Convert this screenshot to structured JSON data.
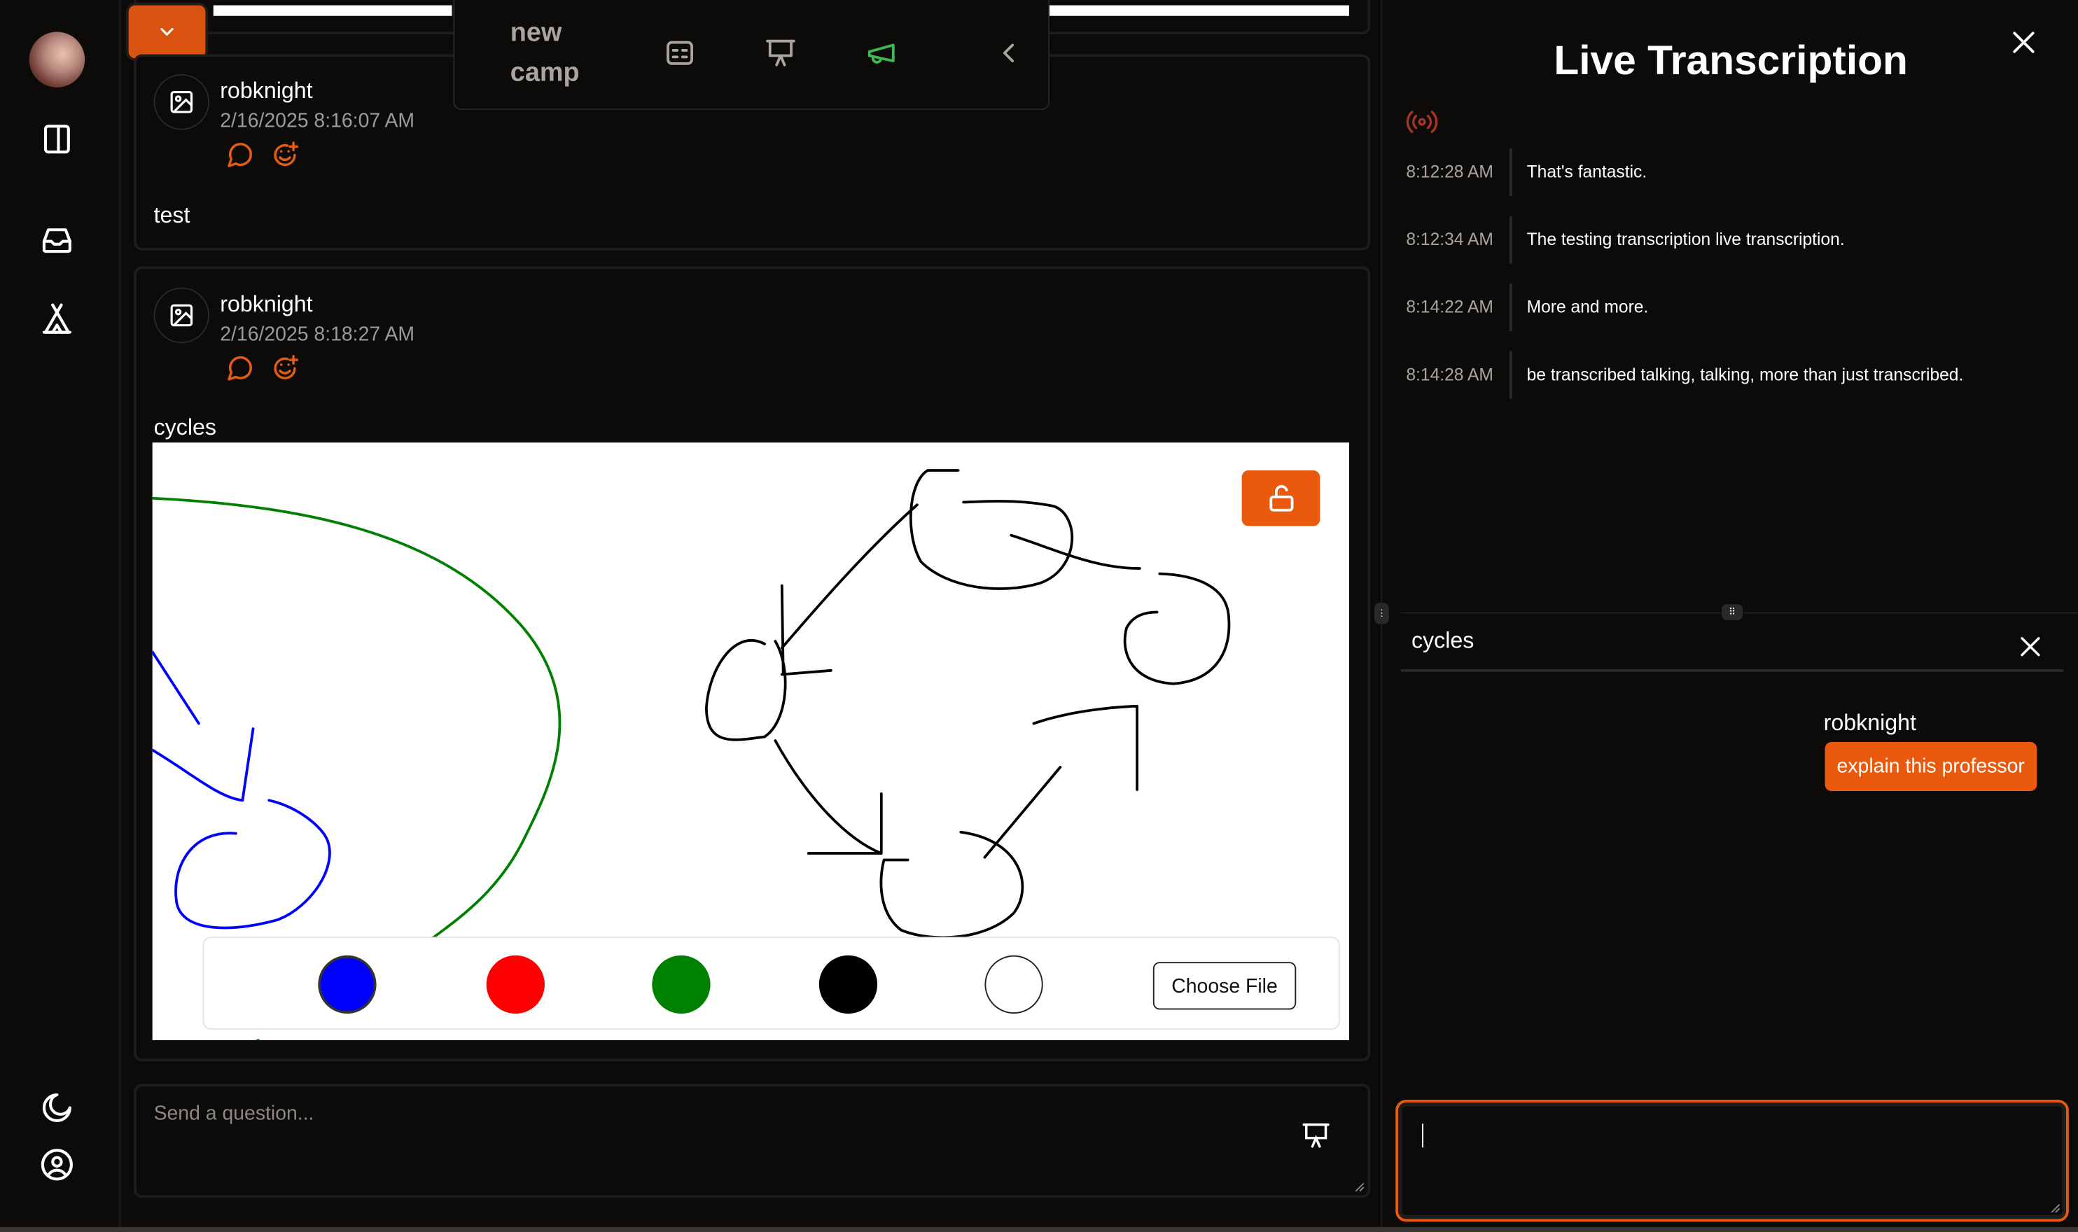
{
  "sidebar": {
    "items": [
      {
        "icon": "avatar",
        "label": "User avatar"
      },
      {
        "icon": "panel-icon",
        "label": "Toggle panel"
      },
      {
        "icon": "inbox-icon",
        "label": "Inbox"
      },
      {
        "icon": "camp-tent-icon",
        "label": "Camps"
      }
    ],
    "bottom": [
      {
        "icon": "moon-icon",
        "label": "Theme"
      },
      {
        "icon": "user-circle-icon",
        "label": "Profile"
      }
    ]
  },
  "toolbar": {
    "title": "new camp",
    "icons": [
      "captions-icon",
      "presentation-icon",
      "megaphone-icon",
      "chevron-left-icon"
    ],
    "megaphone_color": "#3dbb52"
  },
  "messages": [
    {
      "user": "robknight",
      "time": "2/16/2025 8:16:07 AM",
      "text": "test",
      "actions": [
        "reply-icon",
        "add-reaction-icon"
      ]
    },
    {
      "user": "robknight",
      "time": "2/16/2025 8:18:27 AM",
      "text": "cycles",
      "actions": [
        "reply-icon",
        "add-reaction-icon"
      ],
      "attachment": {
        "type": "whiteboard",
        "locked": false,
        "palette": [
          "#0000ff",
          "#ff0000",
          "#008000",
          "#000000",
          "#ffffff"
        ],
        "selected_color": "#0000ff",
        "file_button": "Choose File"
      }
    }
  ],
  "composer": {
    "placeholder": "Send a question...",
    "value": ""
  },
  "transcription": {
    "title": "Live Transcription",
    "status_icon": "broadcast-icon",
    "entries": [
      {
        "time": "8:12:28 AM",
        "text": "That's fantastic."
      },
      {
        "time": "8:12:34 AM",
        "text": "The testing transcription live transcription."
      },
      {
        "time": "8:14:22 AM",
        "text": "More and more."
      },
      {
        "time": "8:14:28 AM",
        "text": "be transcribed talking, talking, more than just transcribed."
      }
    ]
  },
  "thread": {
    "title": "cycles",
    "messages": [
      {
        "user": "robknight",
        "text": "explain this professor"
      }
    ],
    "reply_value": ""
  },
  "colors": {
    "accent": "#ea5a0e",
    "background": "#0c0b0a",
    "border": "#1e1d1c"
  }
}
